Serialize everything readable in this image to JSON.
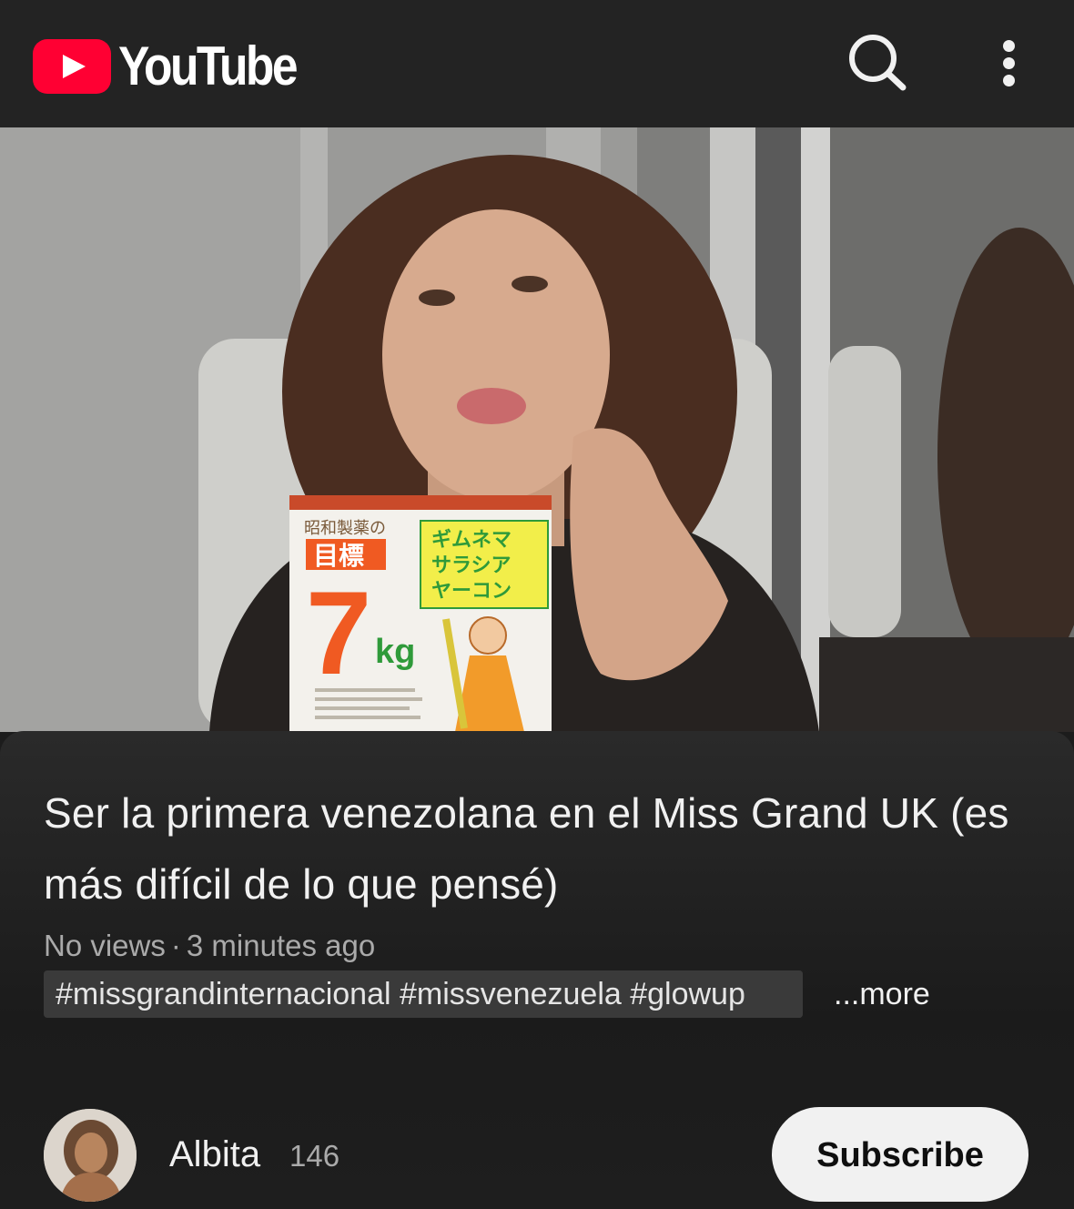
{
  "header": {
    "brand": "YouTube",
    "search_icon": "search-icon",
    "more_icon": "more-vert-icon"
  },
  "video": {
    "thumbnail_product_text": {
      "goal_label": "目標",
      "weight": "7",
      "unit": "kg",
      "sign_lines": [
        "ギムネマ",
        "サラシア",
        "ヤーコン"
      ],
      "brand_line": "昭和製薬の"
    }
  },
  "details": {
    "title": "Ser la primera venezolana en el Miss Grand UK (es más difícil de lo que pensé)",
    "views": "No views",
    "separator": "·",
    "time_ago": "3 minutes ago",
    "hashtags": "#missgrandinternacional #missvenezuela #glowup",
    "more_label": "...more"
  },
  "channel": {
    "name": "Albita",
    "subscriber_count": "146",
    "subscribe_label": "Subscribe"
  },
  "colors": {
    "brand_red": "#ff0033",
    "background": "#1c1c1c",
    "header": "#232323",
    "hashtag_chip": "#3a3a3a",
    "button_bg": "#f1f1f1"
  }
}
